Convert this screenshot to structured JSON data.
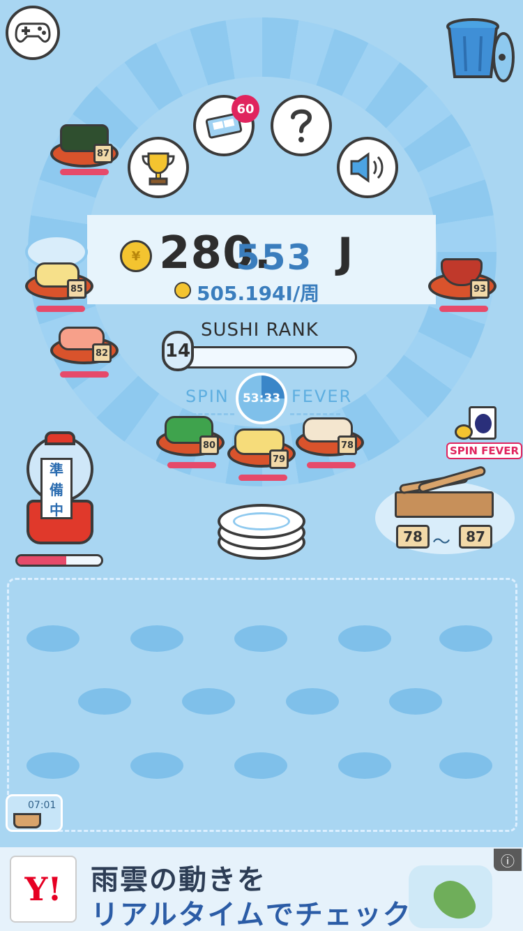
{
  "score": {
    "integer": "280.",
    "decimal": "553",
    "unit": "J",
    "rate": "505.194I/周",
    "coin_symbol": "¥"
  },
  "rank": {
    "label": "SUSHI RANK",
    "level": "14",
    "progress": 0.02
  },
  "spin_fever": {
    "left_label": "SPIN",
    "right_label": "FEVER",
    "timer": "53:33"
  },
  "notifications": {
    "ticket_badge": "60"
  },
  "plates": [
    {
      "name": "maki",
      "number": "87"
    },
    {
      "name": "tamago",
      "number": "85"
    },
    {
      "name": "shrimp",
      "number": "82"
    },
    {
      "name": "gunkan-green",
      "number": "80"
    },
    {
      "name": "egg-nigiri",
      "number": "79"
    },
    {
      "name": "scallop",
      "number": "78"
    },
    {
      "name": "miso-soup",
      "number": "93"
    }
  ],
  "gacha": {
    "status_chars": [
      "準",
      "備",
      "中"
    ],
    "progress": 0.58
  },
  "fever_item": {
    "label": "SPIN FEVER"
  },
  "range": {
    "min": "78",
    "separator": "〜",
    "max": "87"
  },
  "bottom_timer": "07:01",
  "ad": {
    "logo": "Y!",
    "line1": "雨雲の動きを",
    "line2": "リアルタイムでチェック",
    "info": "ⓘ"
  },
  "colors": {
    "background": "#a9d6f2",
    "accent_blue": "#3a7dbd",
    "plate": "#d9532c",
    "plate_bar": "#e64a6a",
    "badge": "#e0245e"
  }
}
